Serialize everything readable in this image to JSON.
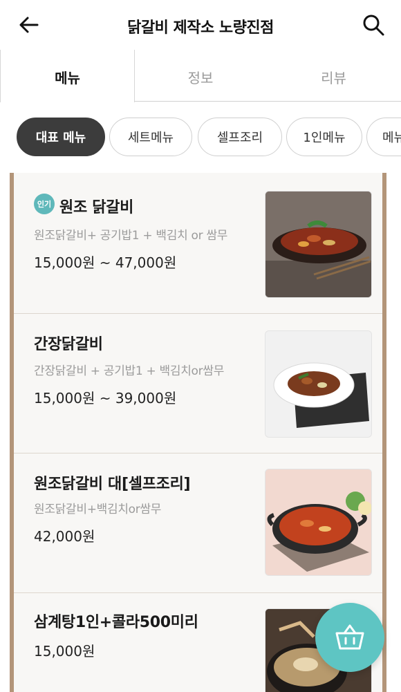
{
  "header": {
    "title": "닭갈비 제작소 노량진점",
    "back_icon": "arrow-left-icon",
    "search_icon": "search-icon"
  },
  "tabs": [
    {
      "label": "메뉴",
      "active": true
    },
    {
      "label": "정보",
      "active": false
    },
    {
      "label": "리뷰",
      "active": false
    }
  ],
  "categories": [
    {
      "label": "대표 메뉴",
      "active": true
    },
    {
      "label": "세트메뉴",
      "active": false
    },
    {
      "label": "셀프조리",
      "active": false
    },
    {
      "label": "1인메뉴",
      "active": false
    },
    {
      "label": "메뉴",
      "active": false
    }
  ],
  "menu_items": [
    {
      "badge": "인기",
      "name": "원조 닭갈비",
      "desc": "원조닭갈비+ 공기밥1 + 백김치 or 쌈무",
      "price": "15,000원 ~ 47,000원",
      "image": "dakgalbi-on-iron-plate"
    },
    {
      "name": "간장닭갈비",
      "desc": "간장닭갈비 + 공기밥1 + 백김치or쌈무",
      "price": "15,000원 ~ 39,000원",
      "image": "soy-dakgalbi-plate"
    },
    {
      "name": "원조닭갈비 대[셀프조리]",
      "desc": "원조닭갈비+백김치or쌈무",
      "price": "42,000원",
      "image": "dakgalbi-pan"
    },
    {
      "name": "삼계탕1인+콜라500미리",
      "price": "15,000원",
      "image": "samgyetang-pot"
    }
  ],
  "fab": {
    "icon": "basket-icon"
  },
  "colors": {
    "accent": "#5ec5c3",
    "badge": "#5fb8ba",
    "frame": "#b39579",
    "chip_active": "#3c3c3c"
  }
}
